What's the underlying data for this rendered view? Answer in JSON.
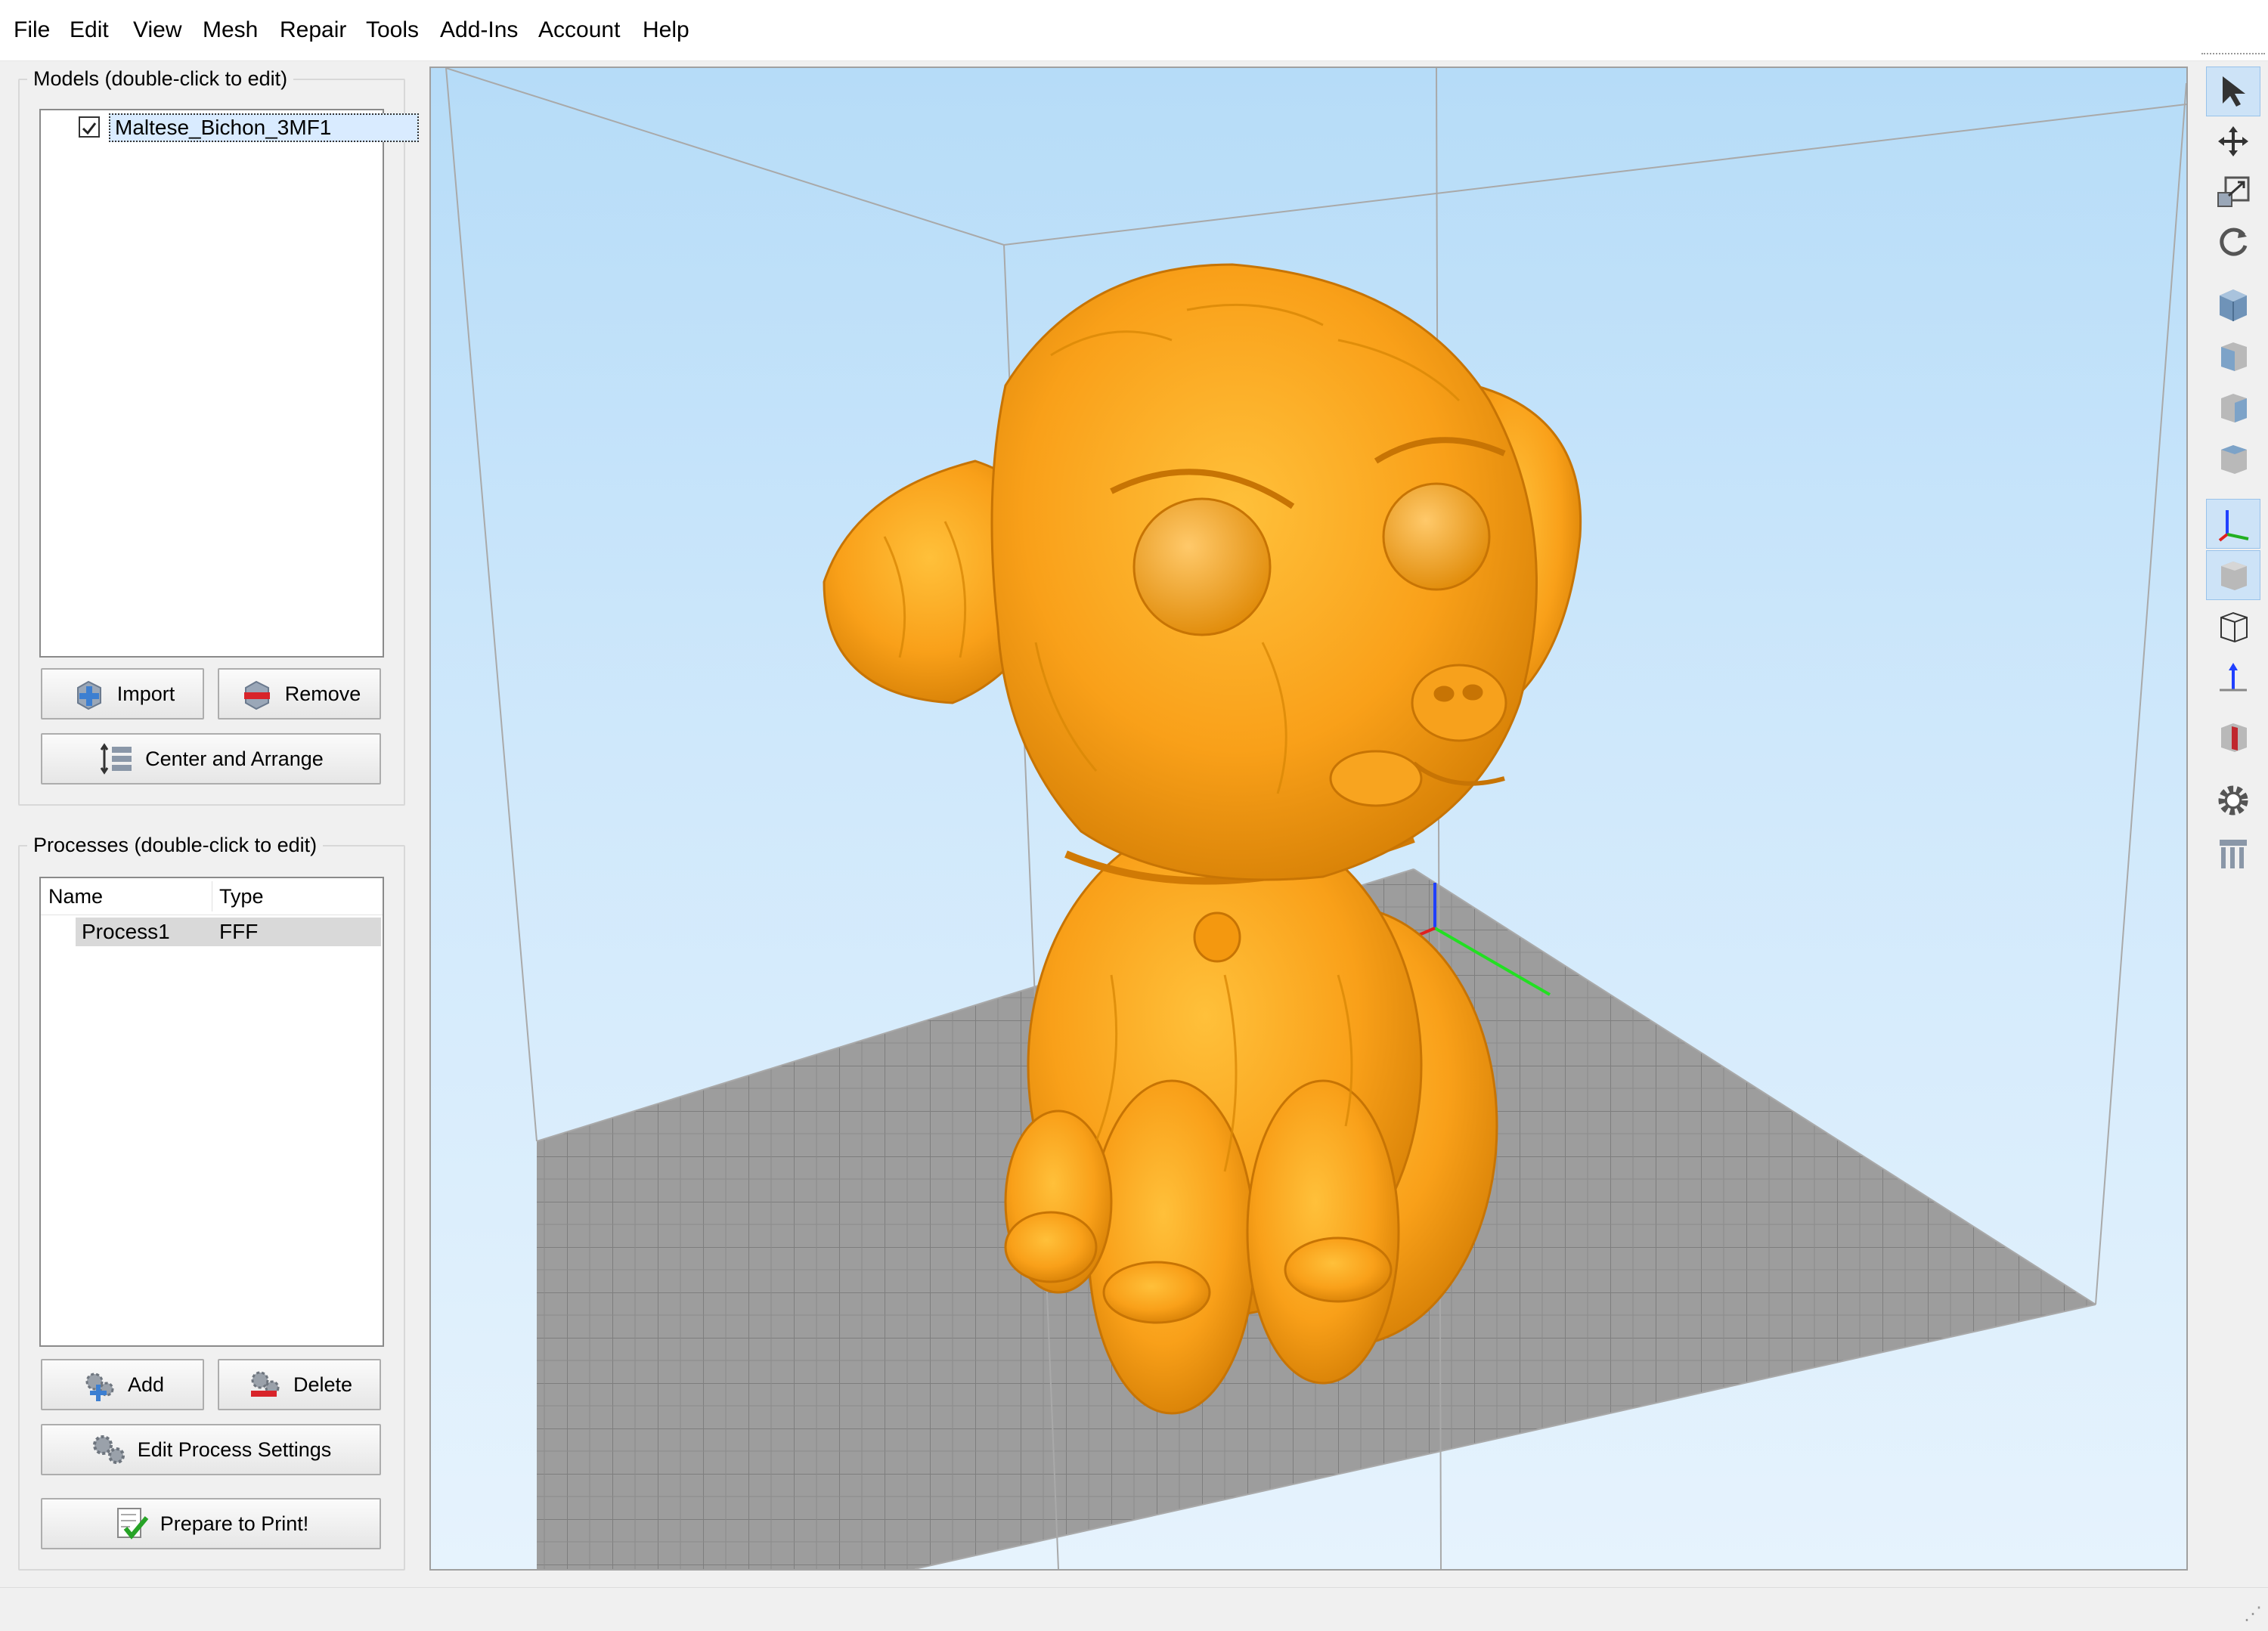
{
  "menu": [
    "File",
    "Edit",
    "View",
    "Mesh",
    "Repair",
    "Tools",
    "Add-Ins",
    "Account",
    "Help"
  ],
  "models": {
    "title": "Models (double-click to edit)",
    "items": [
      {
        "name": "Maltese_Bichon_3MF1",
        "checked": true
      }
    ],
    "import_label": "Import",
    "remove_label": "Remove",
    "center_label": "Center and Arrange"
  },
  "processes": {
    "title": "Processes (double-click to edit)",
    "columns": [
      "Name",
      "Type"
    ],
    "rows": [
      {
        "name": "Process1",
        "type": "FFF"
      }
    ],
    "add_label": "Add",
    "delete_label": "Delete",
    "edit_label": "Edit Process Settings",
    "prepare_label": "Prepare to Print!"
  },
  "toolbar_right": [
    "select-arrow-icon",
    "move-icon",
    "scale-icon",
    "rotate-icon",
    "view-iso-icon",
    "view-front-icon",
    "view-side-icon",
    "view-top-icon",
    "axes-icon",
    "solid-view-icon",
    "wireframe-icon",
    "z-axis-icon",
    "section-view-icon",
    "settings-gear-icon",
    "supports-icon"
  ],
  "colors": {
    "model": "#f9a019",
    "bed": "#9b9b9b",
    "accent": "#3d7fd1"
  }
}
